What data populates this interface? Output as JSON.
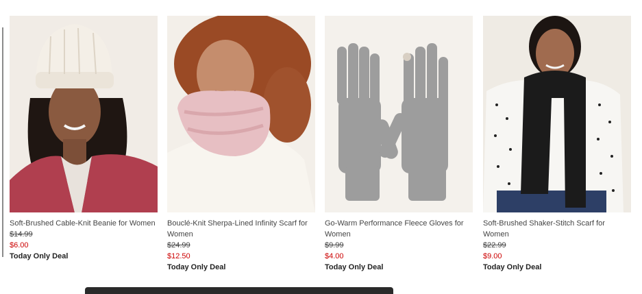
{
  "products": [
    {
      "image": "woman-in-cream-cable-knit-beanie",
      "title": "Soft-Brushed Cable-Knit Beanie for Women",
      "original_price": "$14.99",
      "sale_price": "$6.00",
      "deal_label": "Today Only Deal"
    },
    {
      "image": "woman-in-pink-sherpa-infinity-scarf",
      "title": "Bouclé-Knit Sherpa-Lined Infinity Scarf for Women",
      "original_price": "$24.99",
      "sale_price": "$12.50",
      "deal_label": "Today Only Deal"
    },
    {
      "image": "gray-fleece-gloves",
      "title": "Go-Warm Performance Fleece Gloves for Women",
      "original_price": "$9.99",
      "sale_price": "$4.00",
      "deal_label": "Today Only Deal"
    },
    {
      "image": "woman-in-black-shaker-stitch-scarf",
      "title": "Soft-Brushed Shaker-Stitch Scarf for Women",
      "original_price": "$22.99",
      "sale_price": "$9.00",
      "deal_label": "Today Only Deal"
    }
  ],
  "colors": {
    "sale_price": "#cc0000",
    "text": "#444444"
  }
}
